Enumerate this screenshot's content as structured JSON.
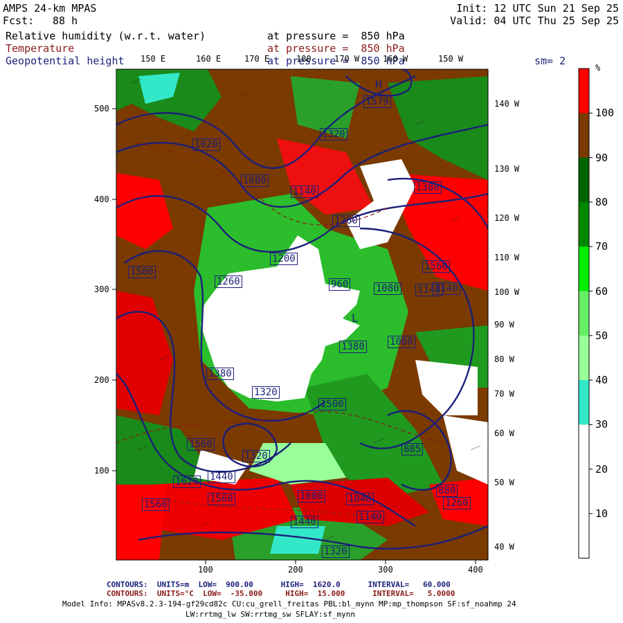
{
  "header": {
    "model": "AMPS 24-km MPAS",
    "fcst_label": "Fcst:",
    "fcst_value": "88 h",
    "init": "Init: 12 UTC Sun 21 Sep 25",
    "valid": "Valid: 04 UTC Thu 25 Sep 25"
  },
  "fields": [
    {
      "name": "Relative humidity (w.r.t. water)",
      "level": "at pressure =  850 hPa",
      "color": "#000000"
    },
    {
      "name": "Temperature",
      "level": "at pressure =  850 hPa",
      "color": "#8b1a1a"
    },
    {
      "name": "Geopotential height",
      "level": "at pressure =  850 hPa",
      "color": "#1b1f7a"
    }
  ],
  "smoothing": "sm= 2",
  "top_longitudes": [
    "150 E",
    "160 E",
    "170 E",
    "180",
    "170 W",
    "160 W",
    "150 W"
  ],
  "right_longitudes": [
    "140 W",
    "130 W",
    "120 W",
    "110 W",
    "100 W",
    "90 W",
    "80 W",
    "70 W",
    "60 W",
    "50 W",
    "40 W"
  ],
  "x_ticks": [
    "100",
    "200",
    "300",
    "400"
  ],
  "y_ticks": [
    "500",
    "400",
    "300",
    "200",
    "100"
  ],
  "colorbar": {
    "unit": "%",
    "labels": [
      "100",
      "90",
      "80",
      "70",
      "60",
      "50",
      "40",
      "30",
      "20",
      "10"
    ],
    "colors": [
      "#ff0000",
      "#7a3a00",
      "#006400",
      "#008800",
      "#00ee00",
      "#66ee66",
      "#99ff99",
      "#33e8c8",
      "#ffffff",
      "#ffffff",
      "#ffffff"
    ]
  },
  "height_labels": [
    "1579",
    "1320",
    "1380",
    "1140",
    "1080",
    "1020",
    "1260",
    "1200",
    "1560",
    "1140",
    "1080",
    "960",
    "1140",
    "1080",
    "1380",
    "1260",
    "1500",
    "1380",
    "1320",
    "1560",
    "1620",
    "1440",
    "1560",
    "1560",
    "1320",
    "1440",
    "1080",
    "1040",
    "880",
    "885",
    "1320",
    "1140",
    "1260",
    "1500"
  ],
  "pressure_symbols": {
    "high": "H",
    "low": "L"
  },
  "contours": [
    {
      "line1": "CONTOURS:  UNITS=m  LOW=  900.00      HIGH=  1620.0      INTERVAL=   60.000",
      "color": "#1b1f7a"
    },
    {
      "line1": "CONTOURS:  UNITS=°C  LOW=  -35.000     HIGH=  15.000      INTERVAL=   5.0000",
      "color": "#8b1a1a"
    }
  ],
  "model_info": "Model Info: MPASv8.2.3-194-gf29cd82c CU:cu_grell_freitas PBL:bl_mynn MP:mp_thompson SF:sf_noahmp 24",
  "model_info2": "LW:rrtmg_lw SW:rrtmg_sw SFLAY:sf_mynn"
}
